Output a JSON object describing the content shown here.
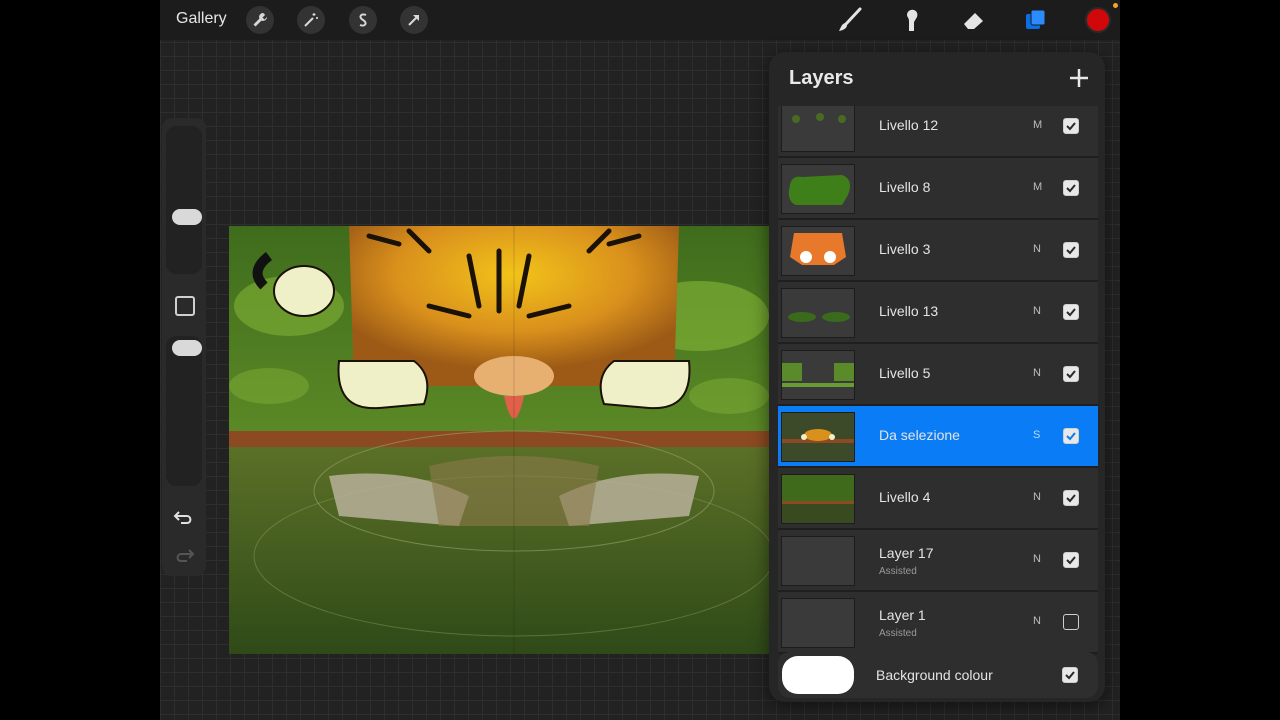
{
  "topbar": {
    "gallery_label": "Gallery",
    "left_tools": [
      "wrench-icon",
      "magic-wand-icon",
      "selection-icon",
      "transform-arrow-icon"
    ],
    "right_tools": [
      "brush-icon",
      "smudge-icon",
      "eraser-icon",
      "layers-icon"
    ],
    "current_color": "#d0080a",
    "accent": "#1a73e8"
  },
  "layers_panel": {
    "title": "Layers",
    "add_icon": "plus-icon",
    "items": [
      {
        "name": "Livello 12",
        "mode": "M",
        "visible": true,
        "selected": false,
        "sub": ""
      },
      {
        "name": "Livello 8",
        "mode": "M",
        "visible": true,
        "selected": false,
        "sub": ""
      },
      {
        "name": "Livello 3",
        "mode": "N",
        "visible": true,
        "selected": false,
        "sub": ""
      },
      {
        "name": "Livello 13",
        "mode": "N",
        "visible": true,
        "selected": false,
        "sub": ""
      },
      {
        "name": "Livello 5",
        "mode": "N",
        "visible": true,
        "selected": false,
        "sub": ""
      },
      {
        "name": "Da selezione",
        "mode": "S",
        "visible": true,
        "selected": true,
        "sub": ""
      },
      {
        "name": "Livello 4",
        "mode": "N",
        "visible": true,
        "selected": false,
        "sub": ""
      },
      {
        "name": "Layer 17",
        "mode": "N",
        "visible": true,
        "selected": false,
        "sub": "Assisted"
      },
      {
        "name": "Layer 1",
        "mode": "N",
        "visible": false,
        "selected": false,
        "sub": "Assisted"
      }
    ],
    "background": {
      "label": "Background colour",
      "visible": true,
      "color": "#ffffff"
    }
  }
}
